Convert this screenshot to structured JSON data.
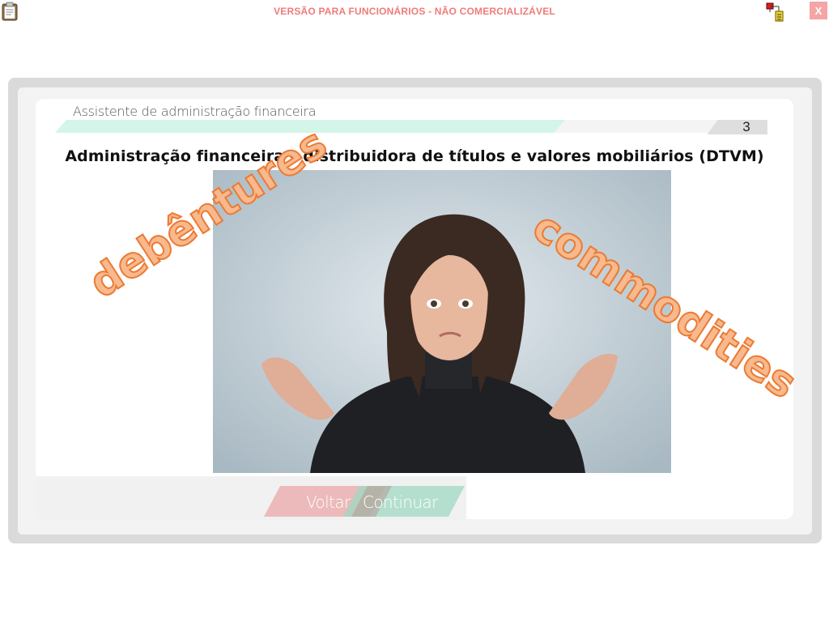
{
  "banner": "VERSÃO PARA FUNCIONÁRIOS - NÃO COMERCIALIZÁVEL",
  "close_label": "X",
  "assistant_title": "Assistente de administração financeira",
  "slide_number": "3",
  "progress": 0.7,
  "heading": "Administração financeira – distribuidora de títulos e valores mobiliários (DTVM)",
  "overlay_words": {
    "left": "debêntures",
    "right": "commodities"
  },
  "buttons": {
    "back": "Voltar",
    "continue": "Continuar"
  },
  "icons": {
    "clipboard": "clipboard-icon",
    "network": "network-icon"
  },
  "colors": {
    "banner": "#f07b7b",
    "progress_fill": "#d3f5ea",
    "word_fill": "#f7b98d",
    "word_stroke": "#ec7a33",
    "back_button": "#e9a3a3",
    "continue_button": "#9fd8c2"
  }
}
